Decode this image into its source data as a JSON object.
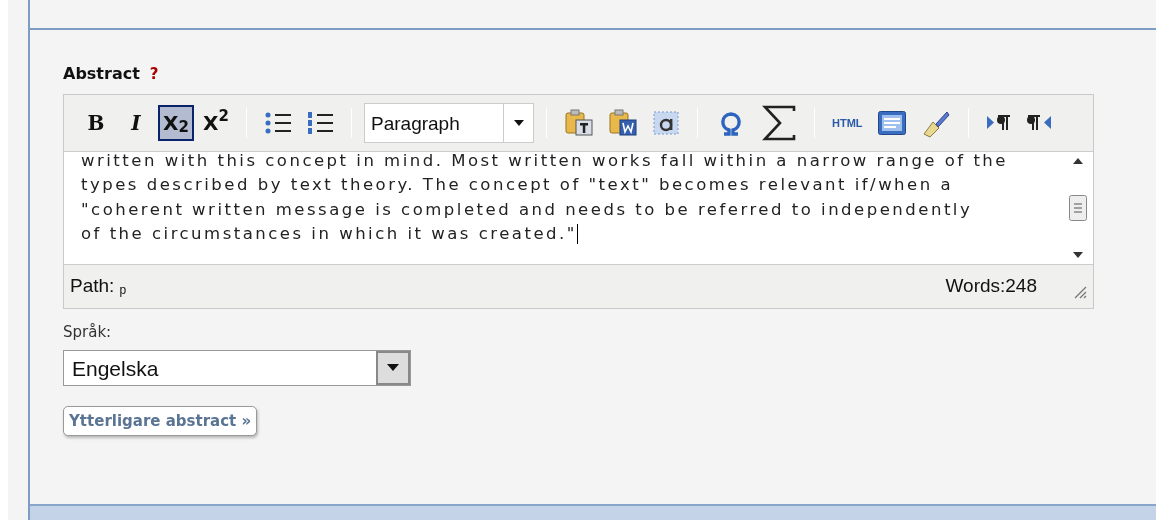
{
  "field_label": "Abstract",
  "help": "?",
  "toolbar": [
    [
      {
        "kind": "label",
        "label": "B",
        "selected": false
      },
      {
        "kind": "label",
        "label": "I",
        "selected": false
      },
      {
        "kind": "label",
        "label": "X$_{2}$",
        "selected": true
      },
      {
        "kind": "label",
        "label": "X$^{2}$",
        "selected": false
      }
    ],
    [
      {
        "kind": "icon",
        "selected": false
      },
      {
        "kind": "icon",
        "selected": false
      }
    ],
    [
      {
        "kind": "select",
        "value": "Paragraph"
      }
    ],
    [
      {
        "kind": "icon",
        "selected": false
      },
      {
        "kind": "icon",
        "selected": false
      },
      {
        "kind": "icon",
        "selected": false
      }
    ],
    [
      {
        "kind": "icon",
        "selected": false
      },
      {
        "kind": "icon",
        "selected": false
      }
    ],
    [
      {
        "kind": "label",
        "label": "HTML",
        "selected": false
      },
      {
        "kind": "icon",
        "selected": false
      },
      {
        "kind": "icon",
        "selected": false
      }
    ],
    [
      {
        "kind": "icon",
        "selected": false
      },
      {
        "kind": "icon",
        "selected": false
      }
    ]
  ],
  "content_lines": [
    "written with this concept in mind. Most written works fall within a narrow range of the",
    "types described by text theory. The concept of \"text\" becomes relevant if/when a",
    "\"coherent written message is completed and needs to be referred to independently",
    "of the circumstances in which it was created.\""
  ],
  "status_bar": {
    "path_label": "Path:",
    "path": "p",
    "words": "Words:248"
  },
  "language": {
    "label": "Språk:",
    "value": "Engelska"
  },
  "more_button": "Ytterligare abstract »"
}
